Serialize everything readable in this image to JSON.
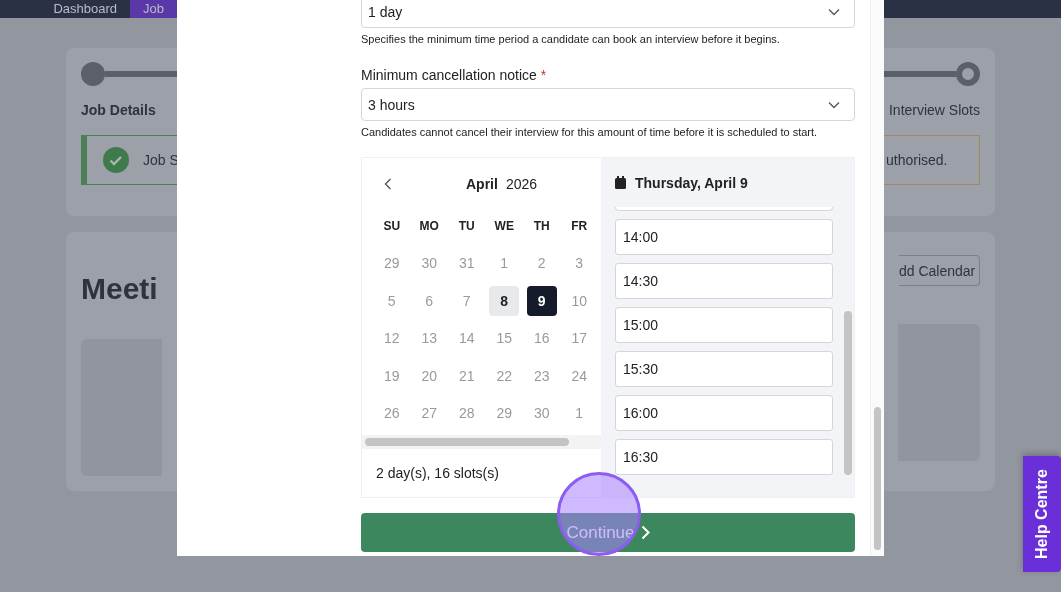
{
  "nav": {
    "items": [
      {
        "label": "Dashboard",
        "selected": false
      },
      {
        "label": "Job",
        "selected": true
      }
    ]
  },
  "stepper": {
    "first_step": "Job Details",
    "last_step": "Interview Slots"
  },
  "alerts": [
    {
      "kind": "success",
      "text": "Job S"
    },
    {
      "kind": "warning",
      "text": "uthorised."
    }
  ],
  "meetings": {
    "title": "Meeti",
    "add_button": "dd Calendar"
  },
  "modal": {
    "booking_notice": {
      "value": "1 day",
      "help": "Specifies the minimum time period a candidate can book an interview before it begins."
    },
    "cancellation": {
      "label": "Minimum cancellation notice",
      "required_mark": "*",
      "value": "3 hours",
      "help": "Candidates cannot cancel their interview for this amount of time before it is scheduled to start."
    },
    "calendar": {
      "month": "April",
      "year": "2026",
      "weekdays": [
        "SU",
        "MO",
        "TU",
        "WE",
        "TH",
        "FR"
      ],
      "weeks": [
        [
          {
            "day": "29",
            "available": false,
            "selected": false
          },
          {
            "day": "30",
            "available": false,
            "selected": false
          },
          {
            "day": "31",
            "available": false,
            "selected": false
          },
          {
            "day": "1",
            "available": false,
            "selected": false
          },
          {
            "day": "2",
            "available": false,
            "selected": false
          },
          {
            "day": "3",
            "available": false,
            "selected": false
          }
        ],
        [
          {
            "day": "5",
            "available": false,
            "selected": false
          },
          {
            "day": "6",
            "available": false,
            "selected": false
          },
          {
            "day": "7",
            "available": false,
            "selected": false
          },
          {
            "day": "8",
            "available": true,
            "selected": false
          },
          {
            "day": "9",
            "available": true,
            "selected": true
          },
          {
            "day": "10",
            "available": false,
            "selected": false
          }
        ],
        [
          {
            "day": "12",
            "available": false,
            "selected": false
          },
          {
            "day": "13",
            "available": false,
            "selected": false
          },
          {
            "day": "14",
            "available": false,
            "selected": false
          },
          {
            "day": "15",
            "available": false,
            "selected": false
          },
          {
            "day": "16",
            "available": false,
            "selected": false
          },
          {
            "day": "17",
            "available": false,
            "selected": false
          }
        ],
        [
          {
            "day": "19",
            "available": false,
            "selected": false
          },
          {
            "day": "20",
            "available": false,
            "selected": false
          },
          {
            "day": "21",
            "available": false,
            "selected": false
          },
          {
            "day": "22",
            "available": false,
            "selected": false
          },
          {
            "day": "23",
            "available": false,
            "selected": false
          },
          {
            "day": "24",
            "available": false,
            "selected": false
          }
        ],
        [
          {
            "day": "26",
            "available": false,
            "selected": false
          },
          {
            "day": "27",
            "available": false,
            "selected": false
          },
          {
            "day": "28",
            "available": false,
            "selected": false
          },
          {
            "day": "29",
            "available": false,
            "selected": false
          },
          {
            "day": "30",
            "available": false,
            "selected": false
          },
          {
            "day": "1",
            "available": false,
            "selected": false
          }
        ]
      ],
      "summary": "2 day(s), 16 slots(s)"
    },
    "slots": {
      "date": "Thursday, April 9",
      "times": [
        "14:00",
        "14:30",
        "15:00",
        "15:30",
        "16:00",
        "16:30"
      ]
    },
    "continue_button": "Continue"
  },
  "help_centre": "Help Centre"
}
